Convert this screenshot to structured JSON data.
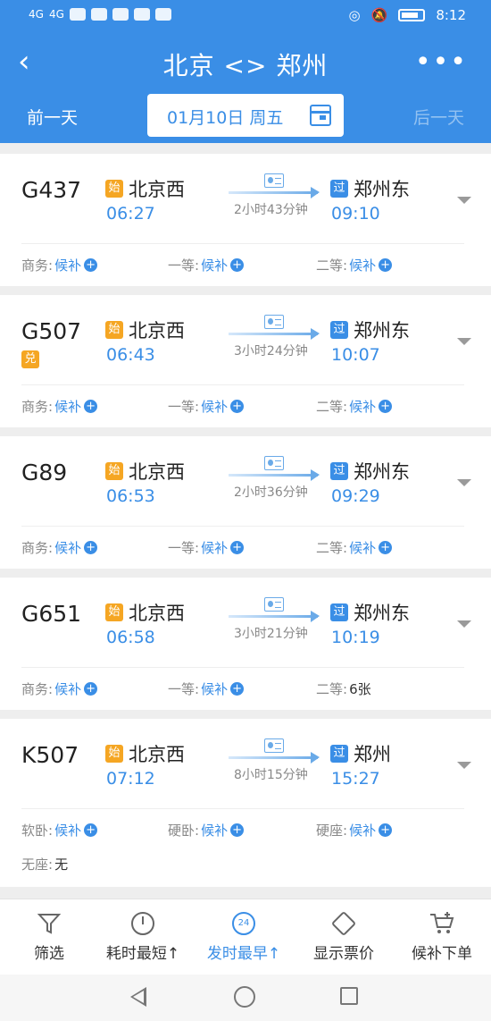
{
  "status_bar": {
    "network_left": "4G",
    "network_right": "4G",
    "time": "8:12"
  },
  "header": {
    "title": "北京 <> 郑州",
    "more": "•••",
    "prev_day": "前一天",
    "next_day": "后一天",
    "date": "01月10日 周五"
  },
  "trains": [
    {
      "number": "G437",
      "badge": "",
      "dep_tag": "始",
      "dep_station": "北京西",
      "dep_time": "06:27",
      "duration": "2小时43分钟",
      "arr_tag": "过",
      "arr_station": "郑州东",
      "arr_time": "09:10",
      "seats": [
        {
          "label": "商务:",
          "value": "候补",
          "plus": true
        },
        {
          "label": "一等:",
          "value": "候补",
          "plus": true
        },
        {
          "label": "二等:",
          "value": "候补",
          "plus": true
        }
      ]
    },
    {
      "number": "G507",
      "badge": "兑",
      "dep_tag": "始",
      "dep_station": "北京西",
      "dep_time": "06:43",
      "duration": "3小时24分钟",
      "arr_tag": "过",
      "arr_station": "郑州东",
      "arr_time": "10:07",
      "seats": [
        {
          "label": "商务:",
          "value": "候补",
          "plus": true
        },
        {
          "label": "一等:",
          "value": "候补",
          "plus": true
        },
        {
          "label": "二等:",
          "value": "候补",
          "plus": true
        }
      ]
    },
    {
      "number": "G89",
      "badge": "",
      "dep_tag": "始",
      "dep_station": "北京西",
      "dep_time": "06:53",
      "duration": "2小时36分钟",
      "arr_tag": "过",
      "arr_station": "郑州东",
      "arr_time": "09:29",
      "seats": [
        {
          "label": "商务:",
          "value": "候补",
          "plus": true
        },
        {
          "label": "一等:",
          "value": "候补",
          "plus": true
        },
        {
          "label": "二等:",
          "value": "候补",
          "plus": true
        }
      ]
    },
    {
      "number": "G651",
      "badge": "",
      "dep_tag": "始",
      "dep_station": "北京西",
      "dep_time": "06:58",
      "duration": "3小时21分钟",
      "arr_tag": "过",
      "arr_station": "郑州东",
      "arr_time": "10:19",
      "seats": [
        {
          "label": "商务:",
          "value": "候补",
          "plus": true
        },
        {
          "label": "一等:",
          "value": "候补",
          "plus": true
        },
        {
          "label": "二等:",
          "value": "6张",
          "plus": false
        }
      ]
    },
    {
      "number": "K507",
      "badge": "",
      "dep_tag": "始",
      "dep_station": "北京西",
      "dep_time": "07:12",
      "duration": "8小时15分钟",
      "arr_tag": "过",
      "arr_station": "郑州",
      "arr_time": "15:27",
      "seats": [
        {
          "label": "软卧:",
          "value": "候补",
          "plus": true
        },
        {
          "label": "硬卧:",
          "value": "候补",
          "plus": true
        },
        {
          "label": "硬座:",
          "value": "候补",
          "plus": true
        },
        {
          "label": "无座:",
          "value": "无",
          "plus": false
        }
      ]
    }
  ],
  "bottom_nav": [
    {
      "label": "筛选",
      "icon": "filter-icon"
    },
    {
      "label": "耗时最短↑",
      "icon": "timer-icon"
    },
    {
      "label": "发时最早↑",
      "icon": "clock-24-icon",
      "active": true
    },
    {
      "label": "显示票价",
      "icon": "price-tag-icon"
    },
    {
      "label": "候补下单",
      "icon": "cart-plus-icon"
    }
  ],
  "colors": {
    "primary": "#3a8ee6",
    "start_tag": "#f5a623"
  }
}
